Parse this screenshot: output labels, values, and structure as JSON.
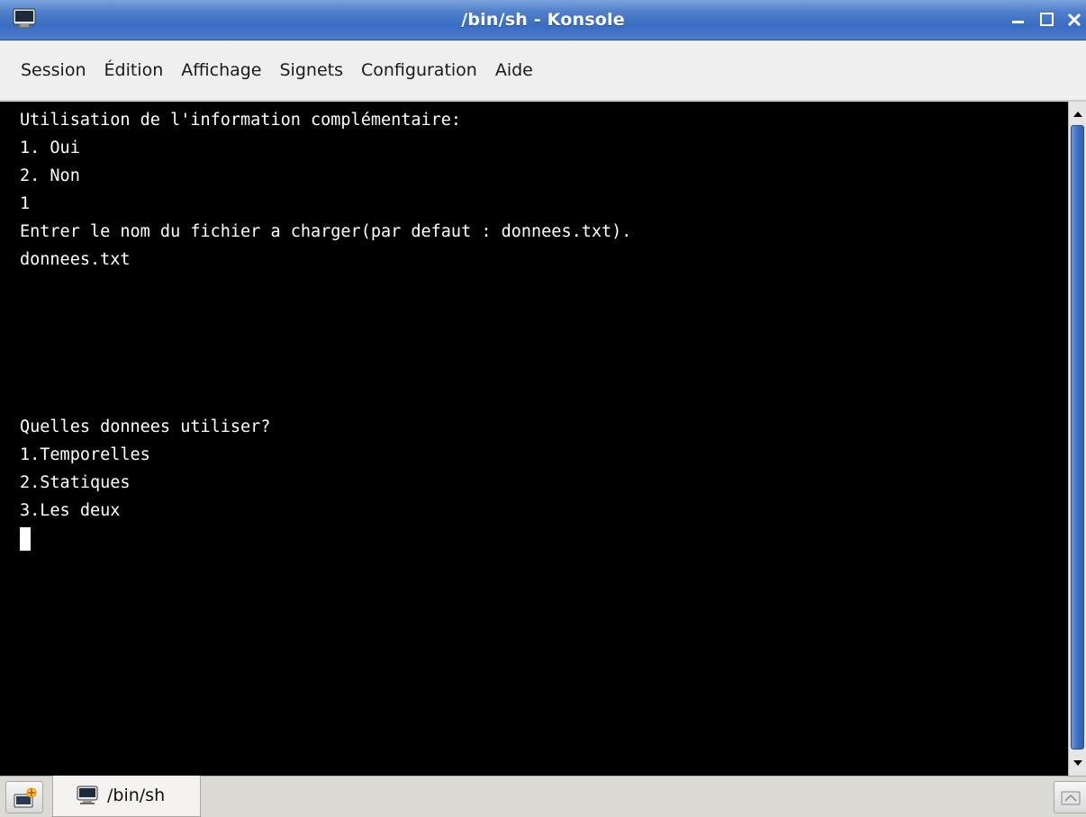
{
  "window": {
    "title": "/bin/sh - Konsole",
    "app_icon": "terminal-icon",
    "controls": [
      "minimize-icon",
      "maximize-icon",
      "close-icon"
    ]
  },
  "menu": {
    "items": [
      "Session",
      "Édition",
      "Affichage",
      "Signets",
      "Configuration",
      "Aide"
    ]
  },
  "terminal": {
    "background": "#000000",
    "foreground": "#ffffff",
    "lines": [
      "Utilisation de l'information complémentaire:",
      "1. Oui",
      "2. Non",
      "1",
      "Entrer le nom du fichier a charger(par defaut : donnees.txt).",
      "donnees.txt",
      "",
      "",
      "",
      "",
      "",
      "Quelles donnees utiliser?",
      "1.Temporelles",
      "2.Statiques",
      "3.Les deux"
    ]
  },
  "tabs": {
    "new_tab_icon": "new-session-icon",
    "items": [
      {
        "label": "/bin/sh",
        "icon": "terminal-icon"
      }
    ],
    "close_icon": "close-session-icon"
  },
  "colors": {
    "titlebar": "#3a6cc0",
    "scroll_thumb": "#3f6fc2"
  }
}
